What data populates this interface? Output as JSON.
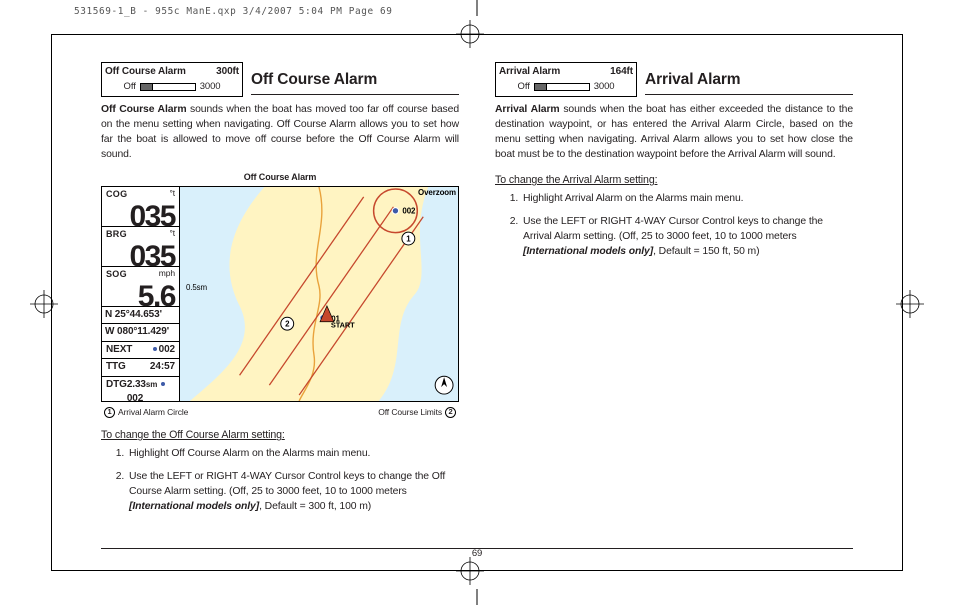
{
  "doc": {
    "header_tag": "531569-1_B - 955c ManE.qxp  3/4/2007  5:04 PM  Page 69",
    "page_number": "69"
  },
  "left": {
    "menu_preview": {
      "title": "Off Course Alarm",
      "value": "300ft",
      "off_label": "Off",
      "max_label": "3000"
    },
    "heading": "Off Course Alarm",
    "lead_bold": "Off Course Alarm",
    "lead_rest": " sounds when the boat has moved too far off course based on the menu setting when navigating. Off Course Alarm allows you to set how far the boat is allowed to move off course before the Off Course Alarm will sound.",
    "figure": {
      "caption": "Off Course Alarm",
      "side": {
        "cog": {
          "label": "COG",
          "unit": "°t",
          "value": "035"
        },
        "brg": {
          "label": "BRG",
          "unit": "°t",
          "value": "035"
        },
        "sog": {
          "label": "SOG",
          "unit": "mph",
          "value": "5.6"
        },
        "lat": "N  25°44.653'",
        "lon": "W 080°11.429'",
        "next": {
          "label": "NEXT",
          "value": "002"
        },
        "ttg": {
          "label": "TTG",
          "value": "24:57"
        },
        "dtg": {
          "label": "DTG",
          "value": "2.33",
          "unit": "sm",
          "suffix_wp": "002"
        }
      },
      "map": {
        "overzoom": "Overzoom",
        "scale": "0.5sm",
        "wp1": "001",
        "wp2": "002",
        "start": "START"
      },
      "key_left": "Arrival Alarm Circle",
      "key_right": "Off Course Limits"
    },
    "subhead": "To change the Off Course Alarm setting:",
    "steps": [
      "Highlight Off Course Alarm on the Alarms main menu.",
      "Use the LEFT or RIGHT 4-WAY Cursor Control keys to change the Off Course Alarm setting. (Off, 25 to 3000 feet, 10 to 1000 meters"
    ],
    "intl_line": "[International models only]",
    "intl_suffix": ", Default = 300 ft, 100 m)"
  },
  "right": {
    "menu_preview": {
      "title": "Arrival Alarm",
      "value": "164ft",
      "off_label": "Off",
      "max_label": "3000"
    },
    "heading": "Arrival Alarm",
    "lead_bold": "Arrival Alarm",
    "lead_rest": " sounds when the boat has either exceeded the distance to the destination waypoint, or has entered the Arrival Alarm Circle, based on the menu setting when navigating. Arrival Alarm allows you to set how close the boat must be to the destination waypoint before the Arrival Alarm will sound.",
    "subhead": "To change the Arrival Alarm setting:",
    "steps": [
      "Highlight Arrival Alarm on the Alarms main menu.",
      "Use the LEFT or RIGHT 4-WAY Cursor Control keys to change the Arrival Alarm setting. (Off, 25 to 3000 feet, 10 to 1000 meters"
    ],
    "intl_line": "[International models only]",
    "intl_suffix": ", Default = 150 ft, 50 m)"
  }
}
